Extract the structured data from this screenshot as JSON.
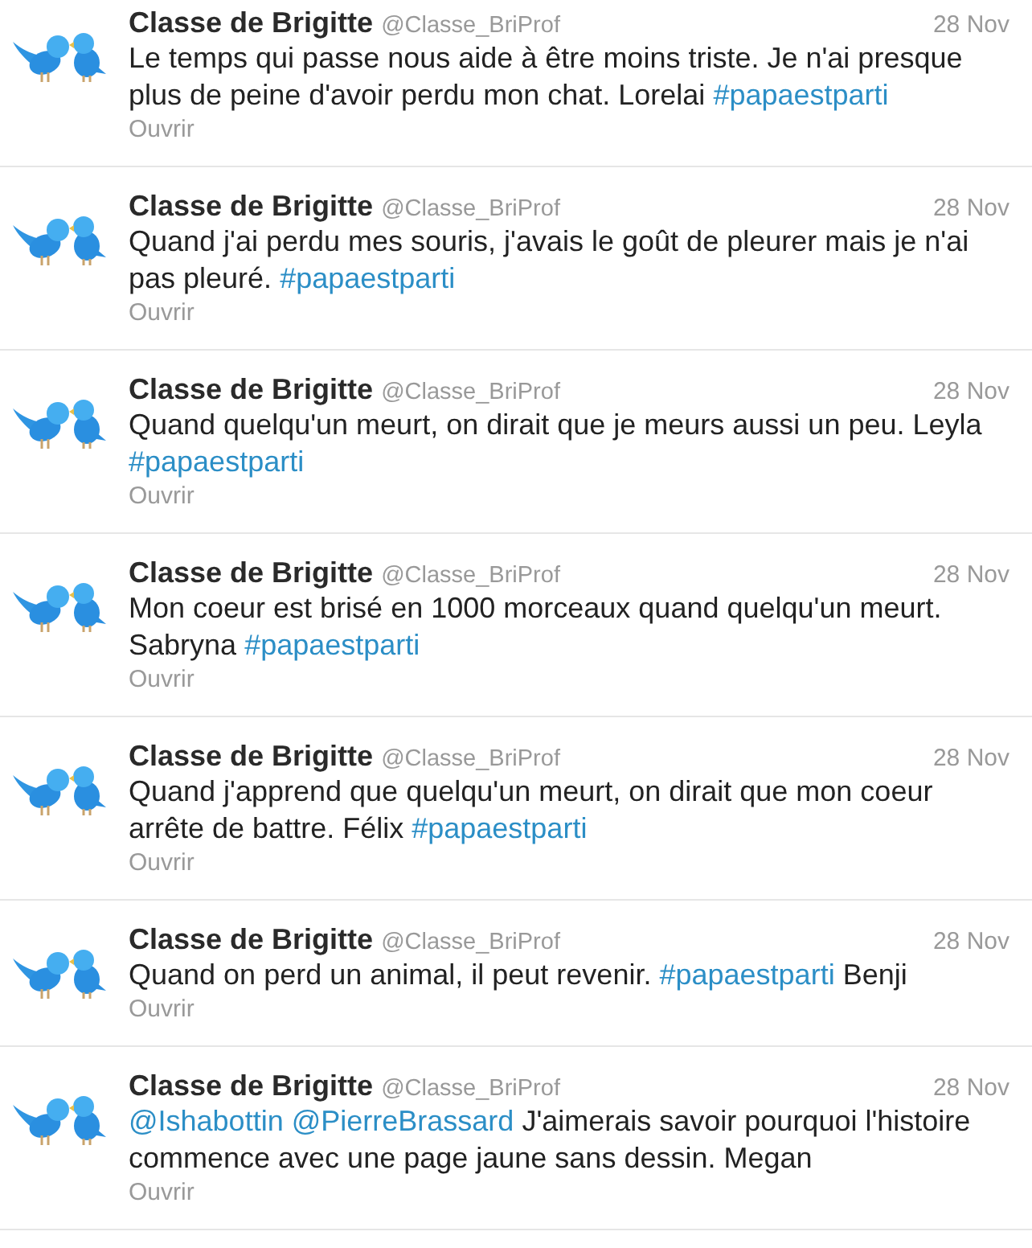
{
  "tweets": [
    {
      "author": "Classe de Brigitte",
      "handle": "@Classe_BriProf",
      "date": "28 Nov",
      "text": [
        {
          "kind": "plain",
          "text": "Le temps qui passe nous aide à être moins triste. Je n'ai presque plus de peine d'avoir perdu mon chat. Lorelai"
        },
        {
          "kind": "hashtag",
          "text": "#papaestparti"
        }
      ],
      "action": "Ouvrir"
    },
    {
      "author": "Classe de Brigitte",
      "handle": "@Classe_BriProf",
      "date": "28 Nov",
      "text": [
        {
          "kind": "plain",
          "text": "Quand j'ai perdu mes souris, j'avais le goût de pleurer mais je n'ai pas pleuré."
        },
        {
          "kind": "hashtag",
          "text": "#papaestparti"
        }
      ],
      "action": "Ouvrir"
    },
    {
      "author": "Classe de Brigitte",
      "handle": "@Classe_BriProf",
      "date": "28 Nov",
      "text": [
        {
          "kind": "plain",
          "text": "Quand quelqu'un meurt, on dirait que je meurs aussi un peu. Leyla"
        },
        {
          "kind": "hashtag",
          "text": "#papaestparti"
        }
      ],
      "action": "Ouvrir"
    },
    {
      "author": "Classe de Brigitte",
      "handle": "@Classe_BriProf",
      "date": "28 Nov",
      "text": [
        {
          "kind": "plain",
          "text": "Mon coeur est brisé en 1000 morceaux quand quelqu'un meurt. Sabryna"
        },
        {
          "kind": "hashtag",
          "text": "#papaestparti"
        }
      ],
      "action": "Ouvrir"
    },
    {
      "author": "Classe de Brigitte",
      "handle": "@Classe_BriProf",
      "date": "28 Nov",
      "text": [
        {
          "kind": "plain",
          "text": "Quand j'apprend que quelqu'un meurt, on dirait que mon coeur arrête de battre. Félix"
        },
        {
          "kind": "hashtag",
          "text": "#papaestparti"
        }
      ],
      "action": "Ouvrir"
    },
    {
      "author": "Classe de Brigitte",
      "handle": "@Classe_BriProf",
      "date": "28 Nov",
      "text": [
        {
          "kind": "plain",
          "text": "Quand on perd un animal, il peut revenir."
        },
        {
          "kind": "hashtag",
          "text": "#papaestparti"
        },
        {
          "kind": "plain",
          "text": "Benji"
        }
      ],
      "action": "Ouvrir"
    },
    {
      "author": "Classe de Brigitte",
      "handle": "@Classe_BriProf",
      "date": "28 Nov",
      "text": [
        {
          "kind": "mention",
          "text": "@Ishabottin"
        },
        {
          "kind": "mention",
          "text": "@PierreBrassard"
        },
        {
          "kind": "plain",
          "text": "J'aimerais savoir pourquoi l'histoire commence avec une page jaune sans dessin. Megan"
        }
      ],
      "action": "Ouvrir"
    }
  ]
}
